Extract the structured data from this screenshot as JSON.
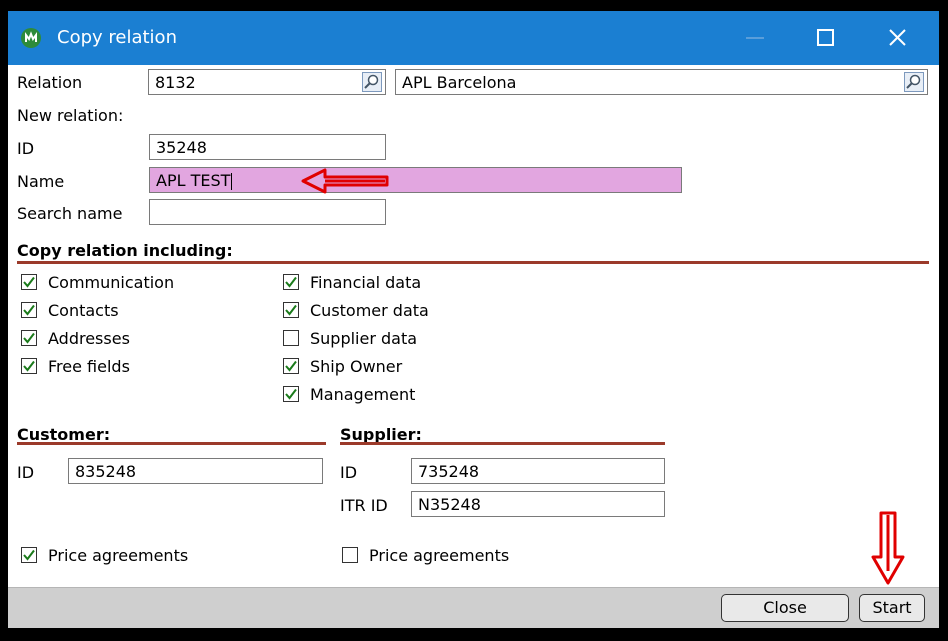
{
  "window": {
    "title": "Copy relation"
  },
  "relation": {
    "label": "Relation",
    "code": "8132",
    "name": "APL Barcelona"
  },
  "new_relation": {
    "heading": "New relation:",
    "id_label": "ID",
    "id_value": "35248",
    "name_label": "Name",
    "name_value": "APL TEST",
    "search_label": "Search name",
    "search_value": ""
  },
  "copy_section": {
    "title": "Copy relation including:",
    "options": [
      {
        "label": "Communication",
        "checked": true
      },
      {
        "label": "Contacts",
        "checked": true
      },
      {
        "label": "Addresses",
        "checked": true
      },
      {
        "label": "Free fields",
        "checked": true
      },
      {
        "label": "Financial data",
        "checked": true
      },
      {
        "label": "Customer data",
        "checked": true
      },
      {
        "label": "Supplier data",
        "checked": false
      },
      {
        "label": "Ship Owner",
        "checked": true
      },
      {
        "label": "Management",
        "checked": true
      }
    ]
  },
  "customer": {
    "title": "Customer:",
    "id_label": "ID",
    "id_value": "835248",
    "price_label": "Price agreements",
    "price_checked": true
  },
  "supplier": {
    "title": "Supplier:",
    "id_label": "ID",
    "id_value": "735248",
    "itr_label": "ITR ID",
    "itr_value": "N35248",
    "price_label": "Price agreements",
    "price_checked": false
  },
  "buttons": {
    "close": "Close",
    "start": "Start"
  },
  "colors": {
    "titlebar": "#1b7fd2",
    "name_highlight": "#e2a6e0",
    "section_rule": "#9b3a2a",
    "check": "#1a7a1a",
    "annotation": "#e00000"
  }
}
